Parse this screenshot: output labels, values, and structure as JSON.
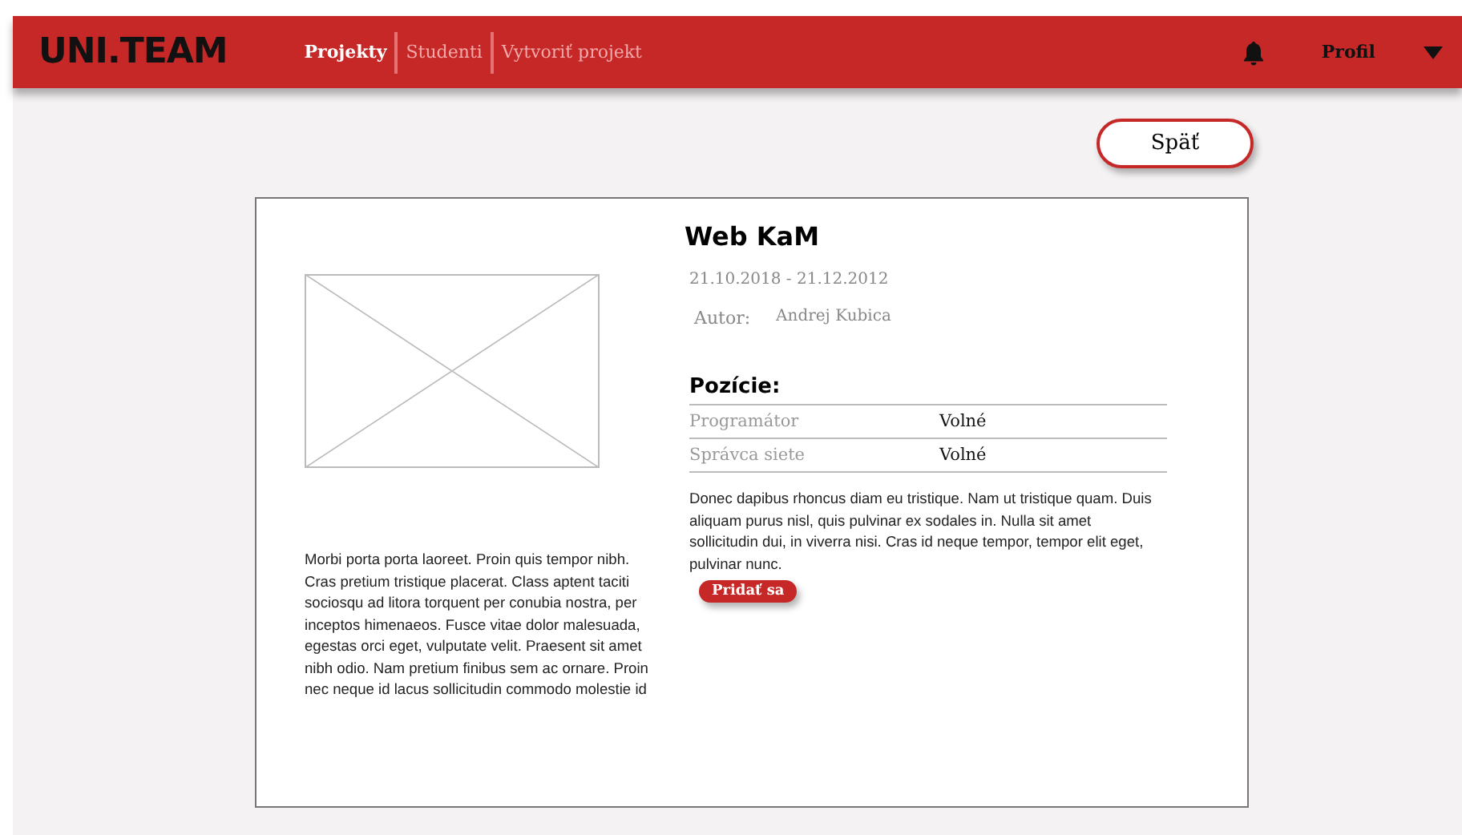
{
  "header": {
    "logo": "UNI.TEAM",
    "nav": [
      {
        "label": "Projekty",
        "selected": true
      },
      {
        "label": "Studenti",
        "selected": false
      },
      {
        "label": "Vytvoriť projekt",
        "selected": false
      }
    ],
    "profile": "Profil"
  },
  "back_button": "Späť",
  "project": {
    "title": "Web KaM",
    "dates": "21.10.2018 - 21.12.2012",
    "author_label": "Autor:",
    "author": "Andrej Kubica",
    "description": "Morbi porta porta laoreet. Proin quis tempor nibh. Cras pretium tristique placerat. Class aptent taciti sociosqu ad litora torquent per conubia nostra, per inceptos himenaeos. Fusce vitae dolor malesuada, egestas orci eget, vulputate velit. Praesent sit amet nibh odio. Nam pretium finibus sem ac ornare. Proin nec neque id lacus sollicitudin commodo molestie id",
    "positions_title": "Pozície:",
    "positions": [
      {
        "role": "Programátor",
        "status": "Volné"
      },
      {
        "role": "Správca siete",
        "status": "Volné"
      }
    ],
    "positions_text": "Donec dapibus rhoncus diam eu tristique. Nam ut tristique quam. Duis aliquam purus nisl, quis pulvinar ex sodales in. Nulla sit amet sollicitudin dui, in viverra nisi. Cras id neque tempor, tempor elit eget, pulvinar nunc.",
    "join_button": "Pridať sa"
  }
}
